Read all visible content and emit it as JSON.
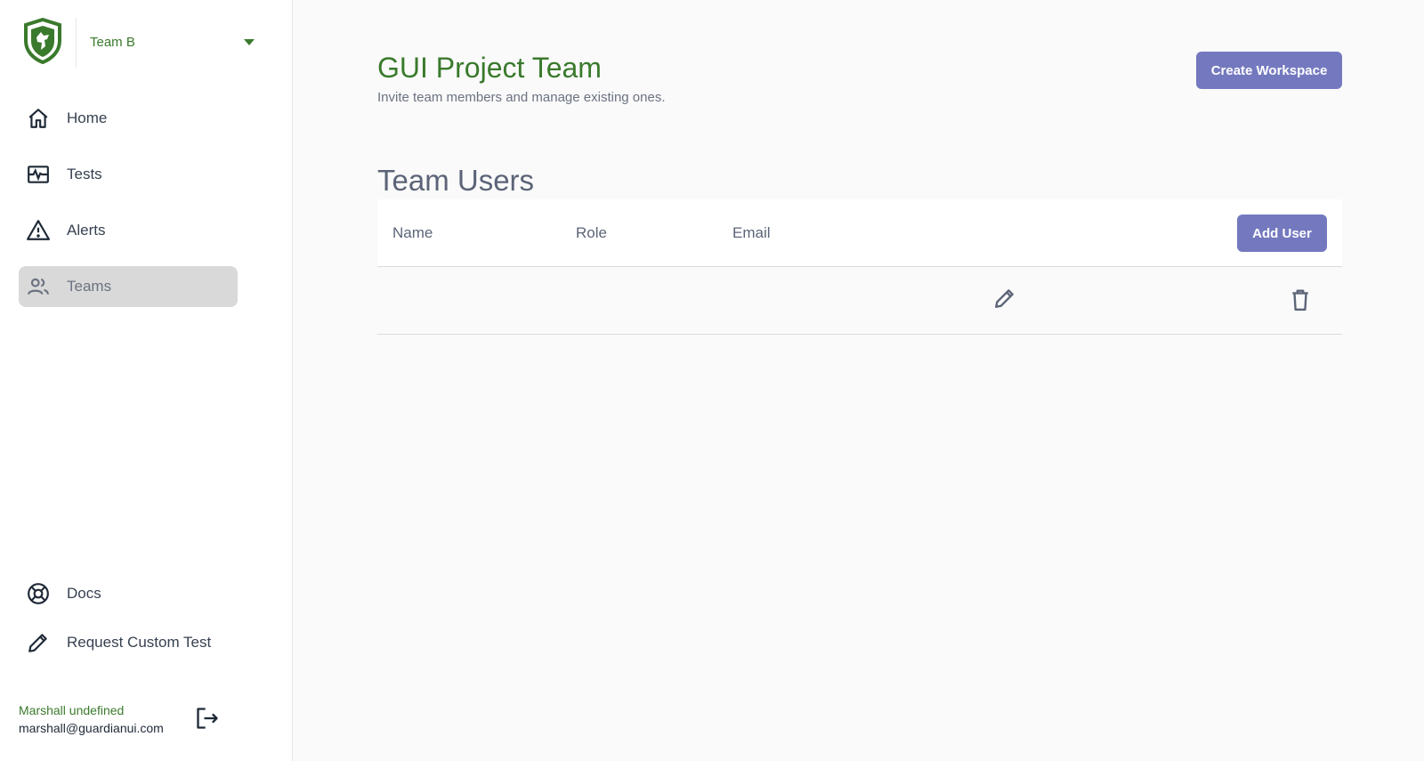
{
  "sidebar": {
    "team_selector": {
      "label": "Team B"
    },
    "nav": [
      {
        "label": "Home",
        "icon": "home-icon"
      },
      {
        "label": "Tests",
        "icon": "tests-icon"
      },
      {
        "label": "Alerts",
        "icon": "alert-triangle-icon"
      },
      {
        "label": "Teams",
        "icon": "users-icon",
        "active": true
      }
    ],
    "bottom_nav": [
      {
        "label": "Docs",
        "icon": "lifebuoy-icon"
      },
      {
        "label": "Request Custom Test",
        "icon": "pencil-icon"
      }
    ],
    "user": {
      "name": "Marshall undefined",
      "email": "marshall@guardianui.com"
    }
  },
  "main": {
    "title": "GUI Project Team",
    "subtitle": "Invite team members and manage existing ones.",
    "create_workspace_label": "Create Workspace",
    "section_title": "Team Users",
    "table": {
      "columns": [
        "Name",
        "Role",
        "Email"
      ],
      "add_user_label": "Add User",
      "rows": [
        {
          "name": "",
          "role": "",
          "email": ""
        }
      ]
    }
  },
  "colors": {
    "brand_green": "#3a7a2c",
    "button_accent": "#7479bf",
    "active_nav_bg": "#d9d9d9"
  }
}
